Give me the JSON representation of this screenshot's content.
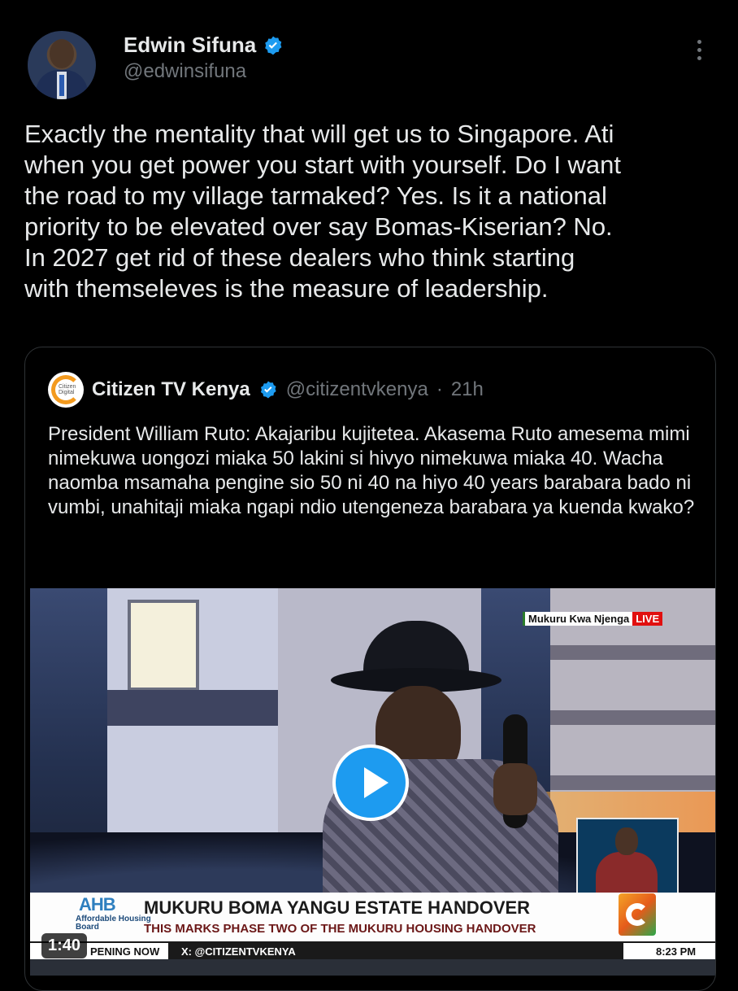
{
  "author": {
    "name": "Edwin Sifuna",
    "handle": "@edwinsifuna"
  },
  "tweet": {
    "lines": [
      "Exactly the mentality that will get us to Singapore. Ati",
      "when you get power you start with yourself. Do I want",
      "the road to my village tarmaked? Yes. Is it a national",
      "priority to be elevated over say Bomas-Kiserian? No.",
      "In 2027 get rid of these dealers who think starting",
      "with themseleves is the measure of leadership."
    ]
  },
  "quote": {
    "logo_text": "Citizen Digital",
    "name": "Citizen TV Kenya",
    "handle": "@citizentvkenya",
    "separator": "·",
    "time": "21h",
    "text": "President William Ruto: Akajaribu kujitetea. Akasema Ruto amesema mimi nimekuwa uongozi miaka 50 lakini si hivyo nimekuwa miaka 40. Wacha naomba msamaha pengine sio 50 ni 40 na hiyo 40 years barabara bado ni vumbi, unahitaji miaka ngapi ndio utengeneza barabara ya kuenda kwako?"
  },
  "video": {
    "location": "Mukuru Kwa Njenga",
    "live": "LIVE",
    "ahb_logo": "AHB",
    "ahb_sub": "Affordable Housing Board",
    "headline": "MUKURU BOMA YANGU ESTATE HANDOVER",
    "subline": "THIS MARKS PHASE TWO OF THE MUKURU HOUSING HANDOVER",
    "ticker_left": "PENING NOW",
    "ticker_mid": "X: @CITIZENTVKENYA",
    "ticker_time": "8:23 PM",
    "duration": "1:40"
  },
  "icons": {
    "verified": "verified-badge-icon",
    "more": "more-options-icon",
    "play": "play-icon"
  },
  "colors": {
    "background": "#000000",
    "text": "#e7e9ea",
    "muted": "#71767b",
    "accent": "#1d9bf0",
    "live_red": "#e10f0f"
  }
}
